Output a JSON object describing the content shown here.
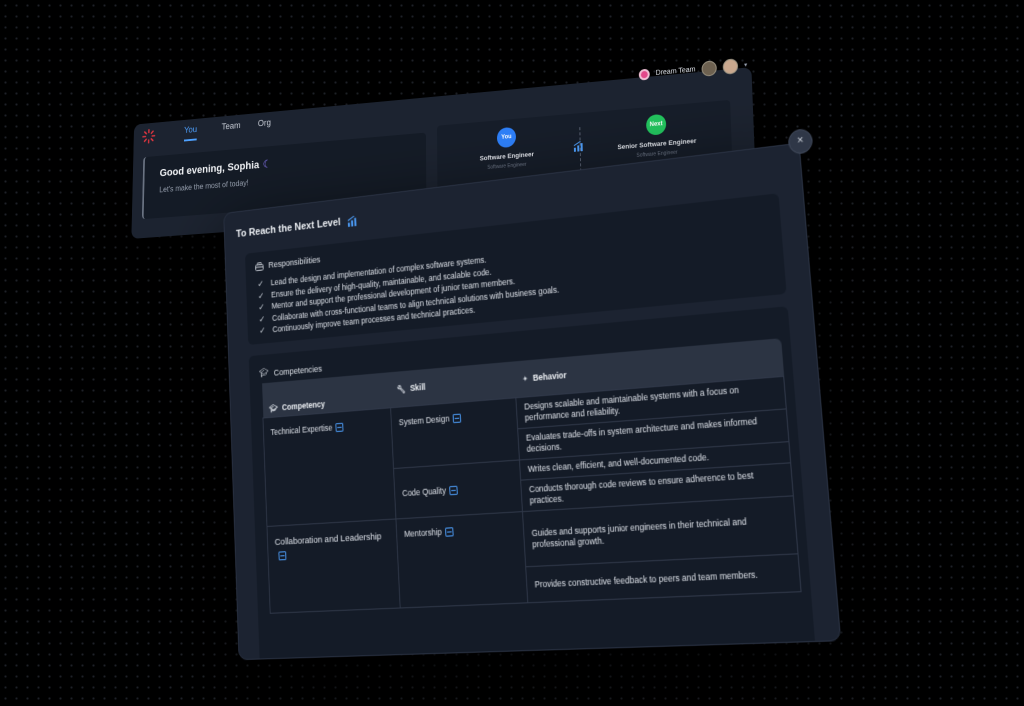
{
  "app": {
    "tabs": [
      {
        "label": "You"
      },
      {
        "label": "Team"
      },
      {
        "label": "Org"
      }
    ],
    "team_switcher": {
      "label": "Dream Team"
    },
    "greeting": {
      "title": "Good evening, Sophia",
      "subtitle": "Let's make the most of today!"
    },
    "levels": {
      "current": {
        "badge": "You",
        "title": "Software Engineer",
        "subtitle": "Software Engineer"
      },
      "next": {
        "badge": "Next",
        "title": "Senior Software Engineer",
        "subtitle": "Software Engineer"
      }
    }
  },
  "modal": {
    "title": "To Reach the Next Level",
    "close_label": "×",
    "responsibilities": {
      "heading": "Responsibilities",
      "items": [
        "Lead the design and implementation of complex software systems.",
        "Ensure the delivery of high-quality, maintainable, and scalable code.",
        "Mentor and support the professional development of junior team members.",
        "Collaborate with cross-functional teams to align technical solutions with business goals.",
        "Continuously improve team processes and technical practices."
      ]
    },
    "competencies": {
      "heading": "Competencies",
      "columns": {
        "competency": "Competency",
        "skill": "Skill",
        "behavior": "Behavior"
      },
      "rows": {
        "technical": "Technical Expertise",
        "system_design": "System Design",
        "code_quality": "Code Quality",
        "collab": "Collaboration and Leadership",
        "mentorship": "Mentorship"
      },
      "behaviors": [
        "Designs scalable and maintainable systems with a focus on performance and reliability.",
        "Evaluates trade-offs in system architecture and makes informed decisions.",
        "Writes clean, efficient, and well-documented code.",
        "Conducts thorough code reviews to ensure adherence to best practices.",
        "Guides and supports junior engineers in their technical and professional growth.",
        "Provides constructive feedback to peers and team members."
      ]
    }
  },
  "colors": {
    "accent": "#4ea1ff",
    "you_badge": "#2d7ff9",
    "next_badge": "#22c55e"
  }
}
